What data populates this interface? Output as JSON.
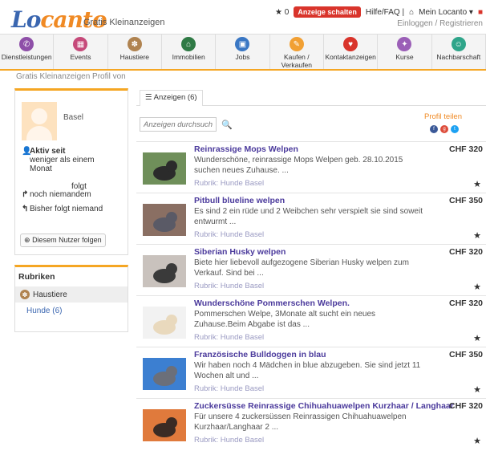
{
  "header": {
    "logo_part1": "Lo",
    "logo_part2": "canto",
    "tagline": "Gratis Kleinanzeigen",
    "star_label": "★ 0",
    "post_button": "Anzeige schalten",
    "help_link": "Hilfe/FAQ |",
    "my_locanto": "Mein Locanto ▾",
    "auth_links": "Einloggen / Registrieren"
  },
  "nav": {
    "items": [
      {
        "label": "Dienstleistungen",
        "icon": "phone-icon",
        "color": "#8e4fa8",
        "glyph": "✆"
      },
      {
        "label": "Events",
        "icon": "calendar-icon",
        "color": "#c64a7a",
        "glyph": "▦"
      },
      {
        "label": "Haustiere",
        "icon": "paw-icon",
        "color": "#b08350",
        "glyph": "✽"
      },
      {
        "label": "Immobilien",
        "icon": "house-icon",
        "color": "#2f7a45",
        "glyph": "⌂"
      },
      {
        "label": "Jobs",
        "icon": "briefcase-icon",
        "color": "#3a77c4",
        "glyph": "▣"
      },
      {
        "label": "Kaufen / Verkaufen",
        "icon": "tag-icon",
        "color": "#f1a034",
        "glyph": "✎"
      },
      {
        "label": "Kontaktanzeigen",
        "icon": "heart-icon",
        "color": "#d9342b",
        "glyph": "♥"
      },
      {
        "label": "Kurse",
        "icon": "graduation-icon",
        "color": "#9b5fb7",
        "glyph": "✦"
      },
      {
        "label": "Nachbarschaft",
        "icon": "people-icon",
        "color": "#2fa58a",
        "glyph": "☺"
      }
    ]
  },
  "breadcrumb": "Gratis Kleinanzeigen   Profil von",
  "profile": {
    "city": "Basel",
    "active_label": "Aktiv seit",
    "active_value": "weniger als einem Monat",
    "follows_label": "folgt",
    "follows_value": "noch niemandem",
    "followers_label": "Bisher folgt niemand",
    "follow_button": "Diesem Nutzer folgen"
  },
  "rubrics": {
    "title": "Rubriken",
    "category": "Haustiere",
    "sub": "Hunde (6)"
  },
  "main": {
    "tab_label": "Anzeigen (6)",
    "search_placeholder": "Anzeigen durchsuchen",
    "share_label": "Profil teilen",
    "social": [
      {
        "name": "facebook-icon",
        "color": "#3b5998",
        "glyph": "f"
      },
      {
        "name": "google-plus-icon",
        "color": "#dd4b39",
        "glyph": "g"
      },
      {
        "name": "twitter-icon",
        "color": "#1da1f2",
        "glyph": "t"
      }
    ]
  },
  "listings": [
    {
      "title": "Reinrassige Mops Welpen",
      "price": "CHF 320",
      "desc": "Wunderschöne, reinrassige Mops Welpen geb. 28.10.2015 suchen neues Zuhause. ...",
      "rubrik": "Rubrik: Hunde Basel",
      "thumb_bg": "#6f8f5a",
      "thumb_fg": "#2b2b2b"
    },
    {
      "title": "Pitbull blueline welpen",
      "price": "CHF 350",
      "desc": "Es sind 2 ein rüde und 2 Weibchen sehr verspielt sie sind soweit entwurmt ...",
      "rubrik": "Rubrik: Hunde Basel",
      "thumb_bg": "#8a6f63",
      "thumb_fg": "#5a5a66"
    },
    {
      "title": "Siberian Husky welpen",
      "price": "CHF 320",
      "desc": "Biete hier liebevoll aufgezogene Siberian Husky welpen zum Verkauf. Sind bei ...",
      "rubrik": "Rubrik: Hunde Basel",
      "thumb_bg": "#c9c2bd",
      "thumb_fg": "#3a3a3a"
    },
    {
      "title": "Wunderschöne Pommerschen Welpen.",
      "price": "CHF 320",
      "desc": "Pommerschen Welpe, 3Monate alt sucht ein neues Zuhause.Beim Abgabe ist das ...",
      "rubrik": "Rubrik: Hunde Basel",
      "thumb_bg": "#f2f2f2",
      "thumb_fg": "#e9d9bd"
    },
    {
      "title": "Französische Bulldoggen in blau",
      "price": "CHF 350",
      "desc": "Wir haben noch 4 Mädchen in blue abzugeben. Sie sind jetzt 11 Wochen alt und ...",
      "rubrik": "Rubrik: Hunde Basel",
      "thumb_bg": "#3c7fd1",
      "thumb_fg": "#6b6f7a"
    },
    {
      "title": "Zuckersüsse Reinrassige Chihuahuawelpen Kurzhaar / Langhaar",
      "price": "CHF 320",
      "desc": "Für unsere 4 zuckersüssen Reinrassigen Chihuahuawelpen Kurzhaar/Langhaar 2 ...",
      "rubrik": "Rubrik: Hunde Basel",
      "thumb_bg": "#e07a3c",
      "thumb_fg": "#3a2b24"
    }
  ]
}
